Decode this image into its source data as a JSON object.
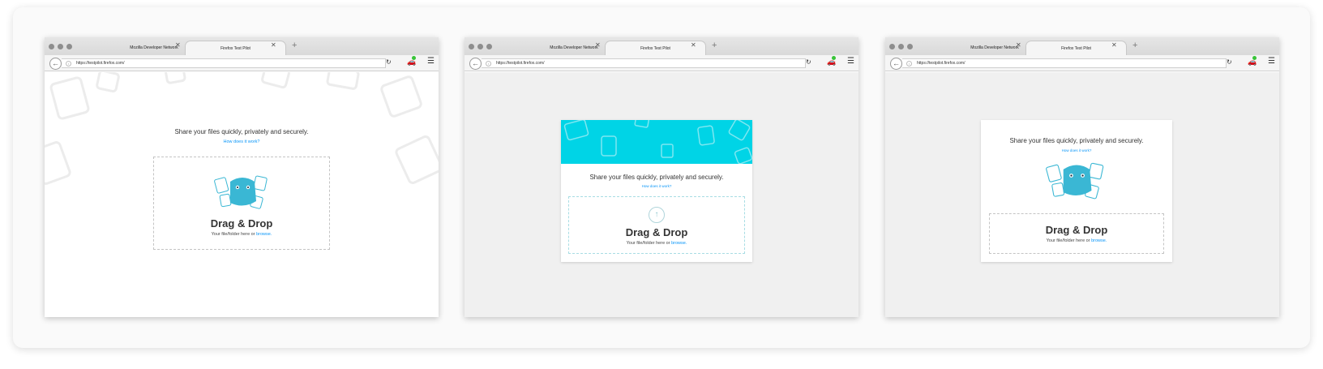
{
  "browsers": [
    {
      "tabs": [
        {
          "label": "Mozilla Developer Network"
        },
        {
          "label": "Firefox Test Pilot"
        }
      ],
      "url": "https://testpilot.firefox.com/",
      "page": {
        "tagline": "Share your files quickly, privately and securely.",
        "how_link": "How does it work?",
        "drop_title": "Drag & Drop",
        "drop_sub": "Your file/folder here or",
        "browse": "browse."
      }
    },
    {
      "tabs": [
        {
          "label": "Mozilla Developer Network"
        },
        {
          "label": "Firefox Test Pilot"
        }
      ],
      "url": "https://testpilot.firefox.com/",
      "page": {
        "tagline": "Share your files quickly, privately and securely.",
        "how_link": "How does it work?",
        "drop_title": "Drag & Drop",
        "drop_sub": "Your file/folder here or",
        "browse": "browse."
      }
    },
    {
      "tabs": [
        {
          "label": "Mozilla Developer Network"
        },
        {
          "label": "Firefox Test Pilot"
        }
      ],
      "url": "https://testpilot.firefox.com/",
      "page": {
        "tagline": "Share your files quickly, privately and securely.",
        "how_link": "How does it work?",
        "drop_title": "Drag & Drop",
        "drop_sub": "Your file/folder here or",
        "browse": "browse."
      }
    }
  ],
  "icons": {
    "back": "back-arrow-icon",
    "info": "info-icon",
    "reload": "reload-icon",
    "testpilot": "test-pilot-icon",
    "menu": "hamburger-menu-icon",
    "close": "close-icon",
    "new_tab": "plus-icon",
    "upload": "upload-arrow-icon"
  },
  "colors": {
    "accent": "#00d4e6",
    "link": "#0996f8",
    "mascot": "#3ab7d4",
    "notify_dot": "#38c438"
  }
}
